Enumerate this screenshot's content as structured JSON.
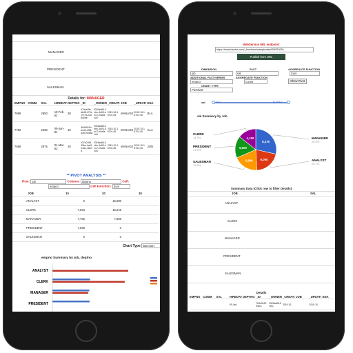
{
  "left": {
    "job_rows": [
      "MANAGER",
      "PRESIDENT",
      "SALESMAN"
    ],
    "details_title": "Details for:",
    "details_job": "MANAGER",
    "emp_headers": [
      "EMPNO",
      "COMM",
      "SAL",
      "HIREDATE",
      "DEPTNO",
      "_ID",
      "_OWNER",
      "_CREATI",
      "JOB",
      "_UPDATI",
      "ENA"
    ],
    "emp_rows": [
      {
        "empno": "7698",
        "sal": "2850",
        "hire": "19-Feb-82",
        "dept": "30",
        "id": "47dca28c-db45-472a-b77d-22d8d0ae",
        "owner": "f003aa86-0ebc-4d03-bec7-e0a5e4c0",
        "created": "2019-10-16T01:45",
        "job": "MANAGER",
        "updated": "2019-10-16T01:45",
        "ena": "BLA"
      },
      {
        "empno": "7782",
        "sal": "2450",
        "hire": "09-Jun-81",
        "dept": "10",
        "id": "484b901d-ac44-43f5-a4f0-9ce8a",
        "owner": "f003aa86-0ebc-4d03-bec7-e0a5e4c0",
        "created": "2019-10-16T01:45",
        "job": "MANAGER",
        "updated": "2019-10-16T01:45",
        "ena": "CLA"
      },
      {
        "empno": "7566",
        "sal": "2975",
        "hire": "01-Mar-83",
        "dept": "20",
        "id": "c37c0165-45bc-4cc5-b4a1-16e0d",
        "owner": "f003aa86-0ebc-4d03-bec7-e0a5e4c0",
        "created": "2019-10-16T01:45",
        "job": "MANAGER",
        "updated": "2019-10-16T01:45",
        "ena": "JON"
      }
    ],
    "pivot_title": "** PIVOT ANALYSIS **",
    "row_label": "Row:",
    "row_value": "job",
    "column_label": "Column:",
    "column_value": "deptno",
    "cell_label": "Cell:",
    "row_value2": "empno",
    "cellfn_label": "Cell Function:",
    "cellfn_value": "Sum",
    "pivot_headers": [
      "JOB",
      "10",
      "20",
      "30"
    ],
    "pivot_rows": [
      {
        "job": "ANALYST",
        "c10": "0",
        "c20": "15,990",
        "c30": ""
      },
      {
        "job": "CLERK",
        "c10": "7,934",
        "c20": "15,245",
        "c30": ""
      },
      {
        "job": "MANAGER",
        "c10": "7,782",
        "c20": "7,566",
        "c30": ""
      },
      {
        "job": "PRESIDENT",
        "c10": "7,839",
        "c20": "0",
        "c30": ""
      },
      {
        "job": "SALESMAN",
        "c10": "0",
        "c20": "0",
        "c30": ""
      }
    ],
    "chart_type_label": "Chart Type",
    "chart_type_value": "BarChart",
    "chart_title": "empno Summary by job, deptno",
    "chart_categories": [
      "ANALYST",
      "CLERK",
      "MANAGER",
      "PRESIDENT"
    ]
  },
  "right": {
    "ws_label": "WebService URL endpoint:",
    "ws_url": "https://www.bsolve.com/_functions/sampledata/EMPDATA",
    "publish_label": "Publish from URL",
    "dimension_label": "DIMENSION",
    "dimension_value": "job",
    "fact_label": "FACT",
    "fact_value": "sal",
    "aggfn_label": "AGGREGATE FUNCTION",
    "aggfn_value": "Sum",
    "addfact_label": "ADDITIONAL FACT/SERIES",
    "addfact_value": "empno",
    "aggfn2_label": "AGGREGATE FUNCTION",
    "aggfn2_value": "Count",
    "show_pivot": "Show Pivot",
    "charttype_label": "CHART TYPE",
    "charttype_value": "PieChart",
    "slider_field": "sal",
    "slider_min": "0.0",
    "slider_max": "6,275.0",
    "pie_title": "sal Summary by Job",
    "summary_title": "Summary Data (Click row to filter Details)",
    "summary_headers": [
      "JOB",
      "SAL"
    ],
    "summary_rows": [
      "ANALYST",
      "CLERK",
      "MANAGER",
      "PRESIDENT",
      "SALESMAN"
    ],
    "details_title": "Details",
    "detail_headers": [
      "EMPNO",
      "COMM",
      "SAL",
      "HIREDATE",
      "DEPTNO",
      "_ID",
      "_OWNER",
      "_CREATI",
      "JOB",
      "_UPDATI",
      "ENA"
    ],
    "detail_row": {
      "id": "7b343167-b4b4-",
      "owner": "f003aa86-0ebc-",
      "hire": "09-Jan-",
      "created": "2019-10-",
      "updated": "2019-10-"
    }
  },
  "chart_data": [
    {
      "type": "bar",
      "title": "empno Summary by job, deptno",
      "categories": [
        "ANALYST",
        "CLERK",
        "MANAGER",
        "PRESIDENT"
      ],
      "series": [
        {
          "name": "10",
          "values": [
            0,
            7934,
            7782,
            7839
          ],
          "color": "#4472c4"
        },
        {
          "name": "20",
          "values": [
            15990,
            15245,
            7566,
            0
          ],
          "color": "#c0392b"
        },
        {
          "name": "30",
          "values": [
            0,
            0,
            0,
            0
          ],
          "color": "#e67e22"
        }
      ]
    },
    {
      "type": "pie",
      "title": "sal Summary by Job",
      "labels": [
        "MANAGER",
        "ANALYST",
        "SALESMAN",
        "PRESIDENT",
        "CLERK"
      ],
      "values": [
        8275,
        6000,
        5600,
        5000,
        4150
      ],
      "display_values": [
        "8,275",
        "6,000",
        "5,600",
        "5,000",
        "4,150"
      ],
      "percents": [
        "28.5%",
        "20.7%",
        "19.3%",
        "17.2%",
        "14.3%"
      ],
      "colors": [
        "#3366cc",
        "#dc3912",
        "#ff9900",
        "#109618",
        "#990099"
      ]
    }
  ]
}
